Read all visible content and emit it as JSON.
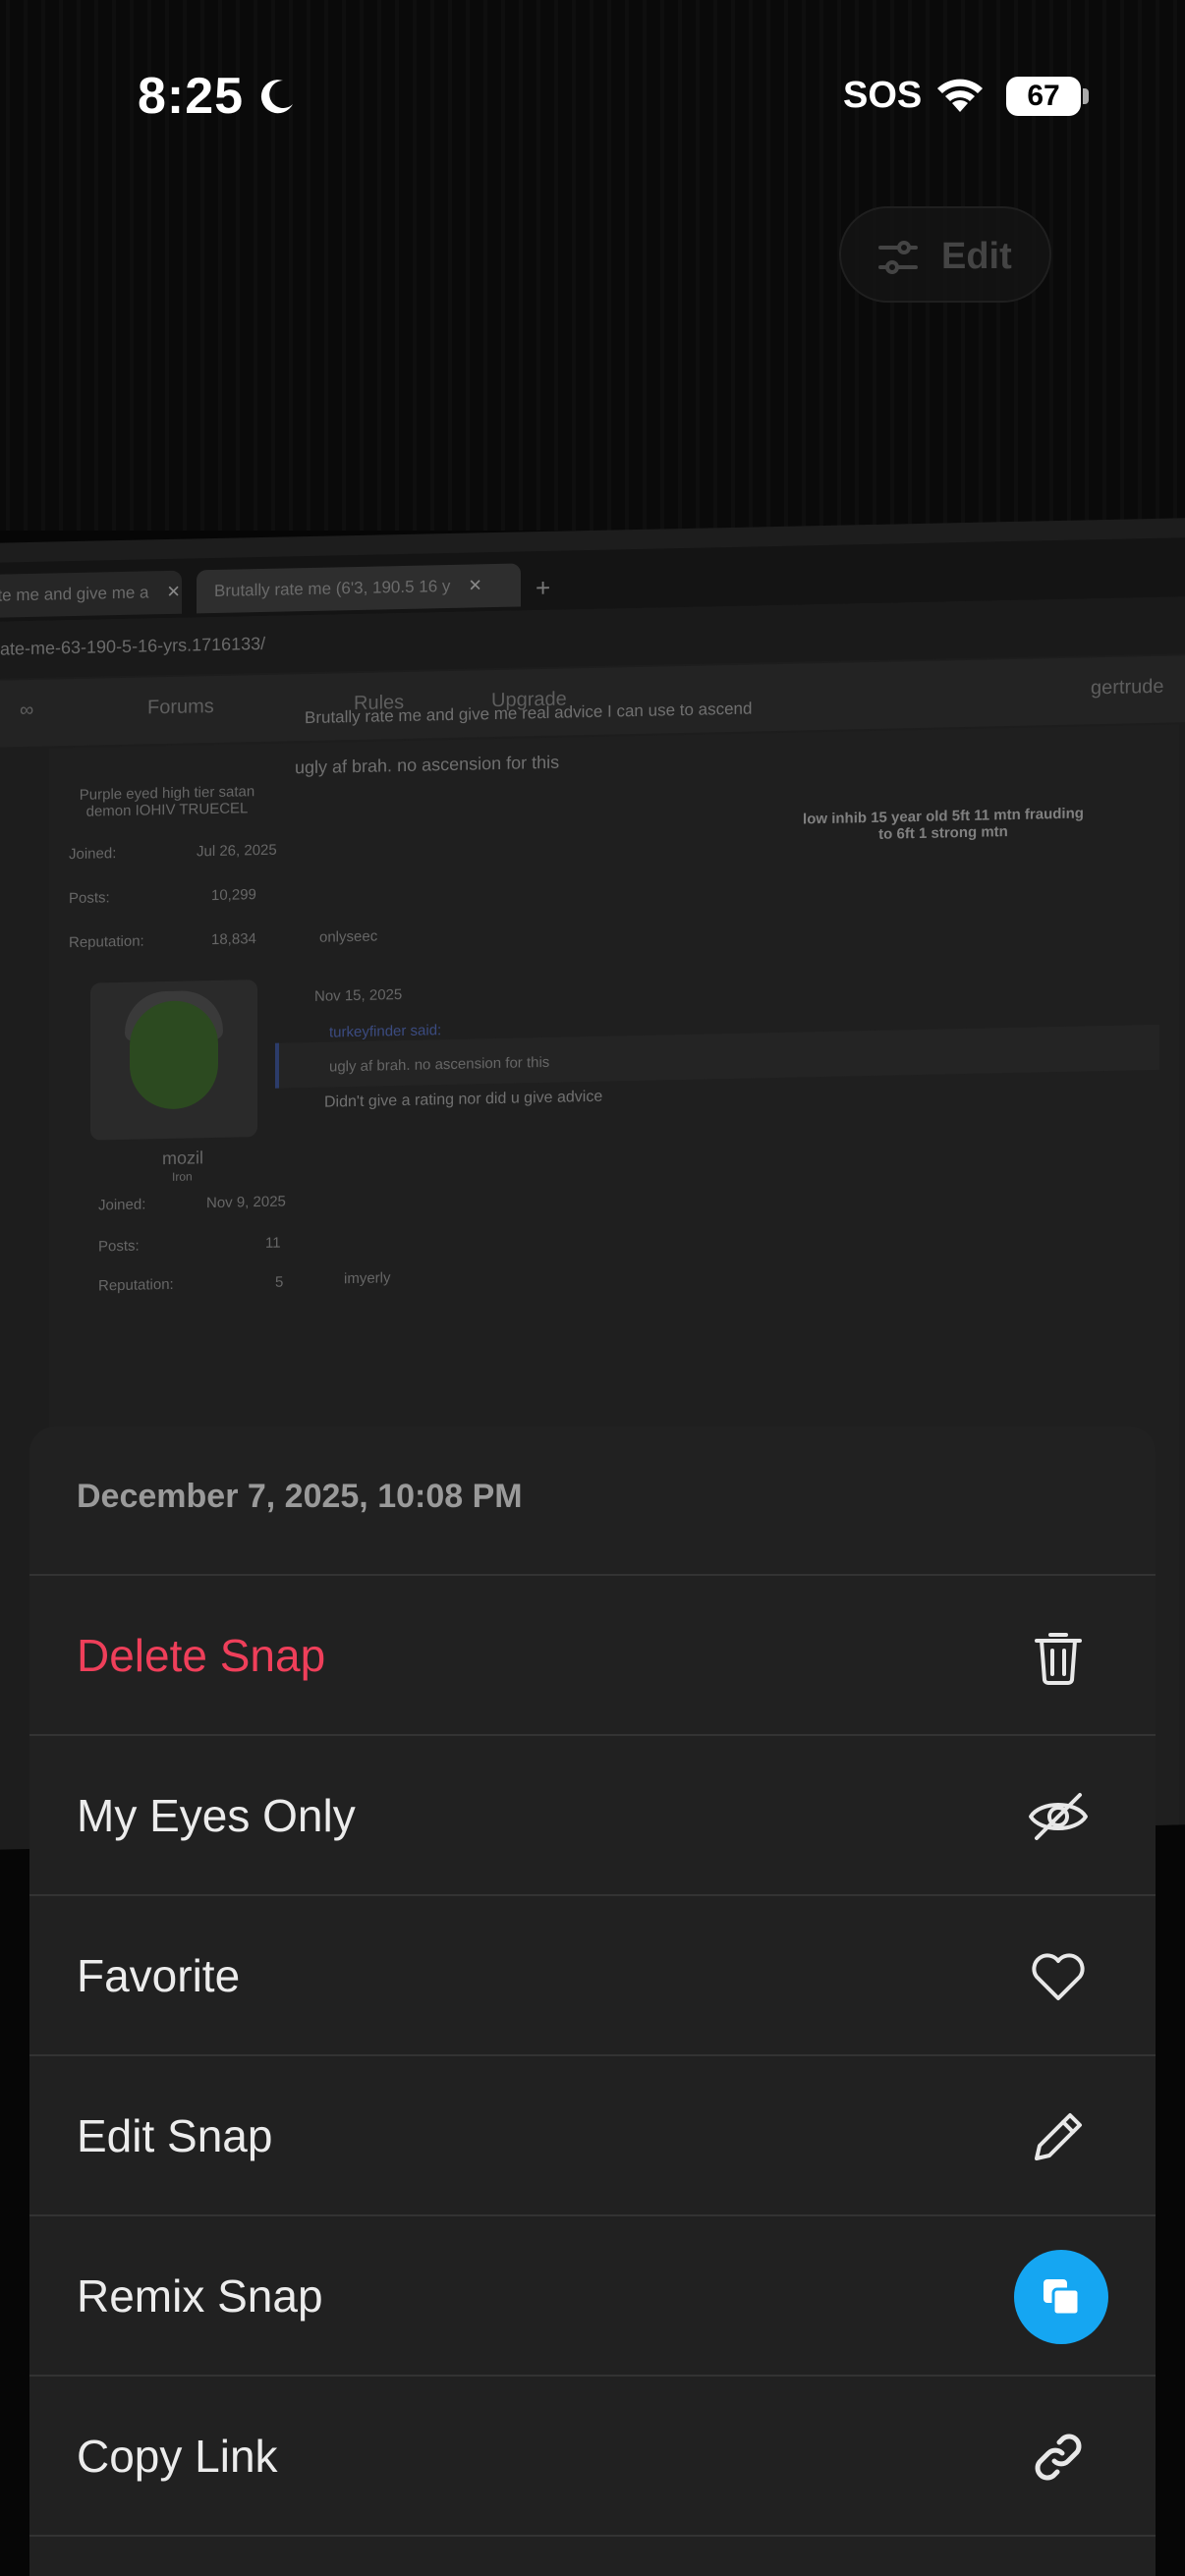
{
  "status_bar": {
    "time": "8:25",
    "carrier": "SOS",
    "battery": "67"
  },
  "edit_button": {
    "label": "Edit"
  },
  "background_photo": {
    "tabs": [
      "ate me and give me a",
      "Brutally rate me (6'3, 190.5 16 y"
    ],
    "url": "ate-me-63-190-5-16-yrs.1716133/",
    "nav": [
      "Forums",
      "Rules",
      "Upgrade"
    ],
    "user_right": "gertrude",
    "thread_title": "Brutally rate me and give me real advice I can use to ascend",
    "post1_text": "ugly af brah. no ascension for this",
    "post1_user_title": "Purple eyed high tier satan demon IOHIV TRUECEL",
    "post1_joined_label": "Joined:",
    "post1_joined": "Jul 26, 2025",
    "post1_posts_label": "Posts:",
    "post1_posts": "10,299",
    "post1_rep_label": "Reputation:",
    "post1_rep": "18,834",
    "signature": "low inhib 15 year old 5ft 11 mtn frauding to 6ft 1 strong mtn",
    "post1_like": "onlyseec",
    "post2_date": "Nov 15, 2025",
    "post2_quote_author": "turkeyfinder said:",
    "post2_quote": "ugly af brah. no ascension for this",
    "post2_text": "Didn't give a rating nor did u give advice",
    "post2_user": "mozil",
    "post2_rank": "Iron",
    "post2_joined_label": "Joined:",
    "post2_joined": "Nov 9, 2025",
    "post2_posts_label": "Posts:",
    "post2_posts": "11",
    "post2_rep_label": "Reputation:",
    "post2_rep": "5",
    "post2_like": "imyerly"
  },
  "sheet": {
    "date": "December 7, 2025, 10:08 PM",
    "items": [
      {
        "label": "Delete Snap",
        "icon": "trash-icon",
        "danger": true
      },
      {
        "label": "My Eyes Only",
        "icon": "eye-slash-icon"
      },
      {
        "label": "Favorite",
        "icon": "heart-icon"
      },
      {
        "label": "Edit Snap",
        "icon": "pencil-icon"
      },
      {
        "label": "Remix Snap",
        "icon": "remix-icon"
      },
      {
        "label": "Copy Link",
        "icon": "link-icon"
      }
    ]
  },
  "colors": {
    "sheet_bg": "#212121",
    "danger": "#ef3f5a",
    "remix_blue": "#15a6f2"
  }
}
